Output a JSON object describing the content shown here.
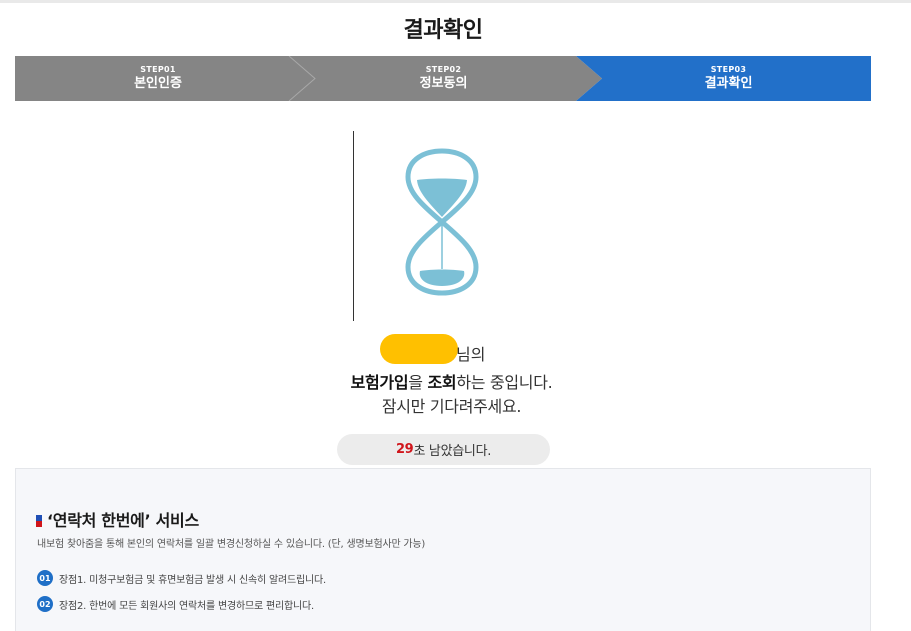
{
  "page": {
    "title": "결과확인"
  },
  "steps": [
    {
      "num": "STEP01",
      "label": "본인인증",
      "active": false
    },
    {
      "num": "STEP02",
      "label": "정보동의",
      "active": false
    },
    {
      "num": "STEP03",
      "label": "결과확인",
      "active": true
    }
  ],
  "colors": {
    "step_inactive": "#858585",
    "step_active": "#2270c9",
    "mask": "#ffc000",
    "countdown_accent": "#d0151b",
    "badge": "#1f6fc7"
  },
  "progress_icon": "hourglass-icon",
  "message": {
    "name_suffix": "님의",
    "line1": {
      "strong1": "보험가입",
      "mid": "을 ",
      "strong2": "조회",
      "end": "하는 중입니다."
    },
    "line2": "잠시만 기다려주세요."
  },
  "countdown": {
    "seconds": "29",
    "text": "초 남았습니다."
  },
  "service": {
    "title": "‘연락처 한번에’ 서비스",
    "description": "내보험 찾아줌을 통해 본인의 연락처를 일괄 변경신청하실 수 있습니다. (단, 생명보험사만 가능)",
    "items": [
      {
        "badge": "01",
        "text": "장점1. 미청구보험금 및 휴면보험금 발생 시 신속히 알려드립니다."
      },
      {
        "badge": "02",
        "text": "장점2. 한번에 모든 회원사의 연락처를 변경하므로 편리합니다."
      }
    ]
  }
}
